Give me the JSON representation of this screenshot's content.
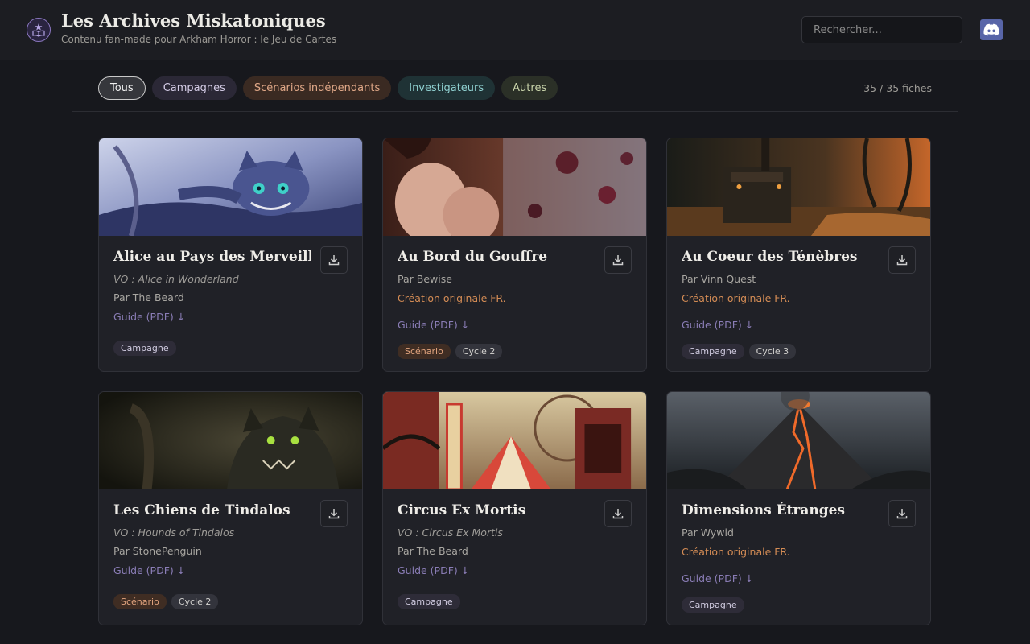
{
  "header": {
    "title": "Les Archives Miskatoniques",
    "subtitle": "Contenu fan-made pour Arkham Horror : le Jeu de Cartes",
    "search_placeholder": "Rechercher...",
    "logo_icon": "book-star-icon",
    "discord_icon": "discord-icon"
  },
  "filters": [
    {
      "label": "Tous"
    },
    {
      "label": "Campagnes"
    },
    {
      "label": "Scénarios indépendants"
    },
    {
      "label": "Investigateurs"
    },
    {
      "label": "Autres"
    }
  ],
  "count": "35 / 35 fiches",
  "colors": {
    "accent": "#8a7db6",
    "original": "#d48c55",
    "background": "#17181d",
    "card": "#202127"
  },
  "cards": [
    {
      "title": "Alice au Pays des Merveilles",
      "vo": "VO : Alice in Wonderland",
      "author": "Par The Beard",
      "original": "",
      "guide": "Guide (PDF) ↓",
      "tags": [
        {
          "label": "Campagne",
          "kind": "camp"
        }
      ]
    },
    {
      "title": "Au Bord du Gouffre",
      "vo": "",
      "author": "Par Bewise",
      "original": "Création originale FR.",
      "guide": "Guide (PDF) ↓",
      "tags": [
        {
          "label": "Scénario",
          "kind": "scen"
        },
        {
          "label": "Cycle 2",
          "kind": "cycle"
        }
      ]
    },
    {
      "title": "Au Coeur des Ténèbres",
      "vo": "",
      "author": "Par Vinn Quest",
      "original": "Création originale FR.",
      "guide": "Guide (PDF) ↓",
      "tags": [
        {
          "label": "Campagne",
          "kind": "camp"
        },
        {
          "label": "Cycle 3",
          "kind": "cycle"
        }
      ]
    },
    {
      "title": "Les Chiens de Tindalos",
      "vo": "VO : Hounds of Tindalos",
      "author": "Par StonePenguin",
      "original": "",
      "guide": "Guide (PDF) ↓",
      "tags": [
        {
          "label": "Scénario",
          "kind": "scen"
        },
        {
          "label": "Cycle 2",
          "kind": "cycle"
        }
      ]
    },
    {
      "title": "Circus Ex Mortis",
      "vo": "VO : Circus Ex Mortis",
      "author": "Par The Beard",
      "original": "",
      "guide": "Guide (PDF) ↓",
      "tags": [
        {
          "label": "Campagne",
          "kind": "camp"
        }
      ]
    },
    {
      "title": "Dimensions Étranges",
      "vo": "",
      "author": "Par Wywid",
      "original": "Création originale FR.",
      "guide": "Guide (PDF) ↓",
      "tags": [
        {
          "label": "Campagne",
          "kind": "camp"
        }
      ]
    }
  ]
}
